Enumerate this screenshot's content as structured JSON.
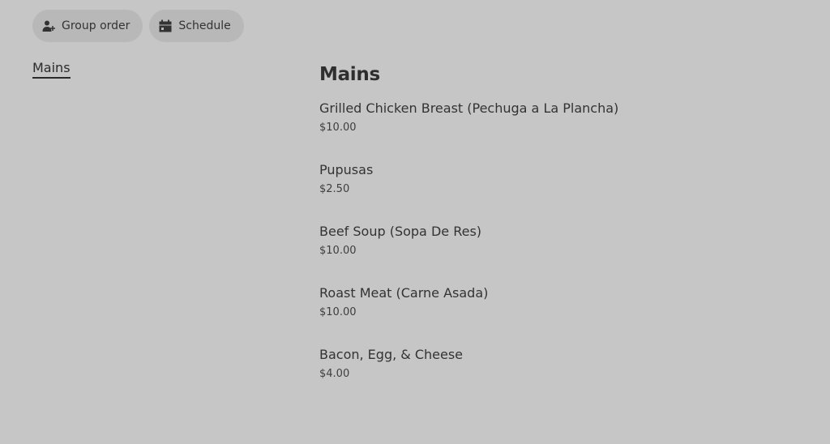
{
  "top_actions": {
    "group_order": {
      "label": "Group order",
      "icon": "add-person-icon"
    },
    "schedule": {
      "label": "Schedule",
      "icon": "calendar-icon"
    }
  },
  "sidebar": {
    "items": [
      {
        "label": "Mains",
        "active": true
      }
    ]
  },
  "menu": {
    "section_title": "Mains",
    "items": [
      {
        "name": "Grilled Chicken Breast (Pechuga a La Plancha)",
        "price": "$10.00"
      },
      {
        "name": "Pupusas",
        "price": "$2.50"
      },
      {
        "name": "Beef Soup (Sopa De Res)",
        "price": "$10.00"
      },
      {
        "name": "Roast Meat (Carne Asada)",
        "price": "$10.00"
      },
      {
        "name": "Bacon, Egg, & Cheese",
        "price": "$4.00"
      }
    ]
  }
}
